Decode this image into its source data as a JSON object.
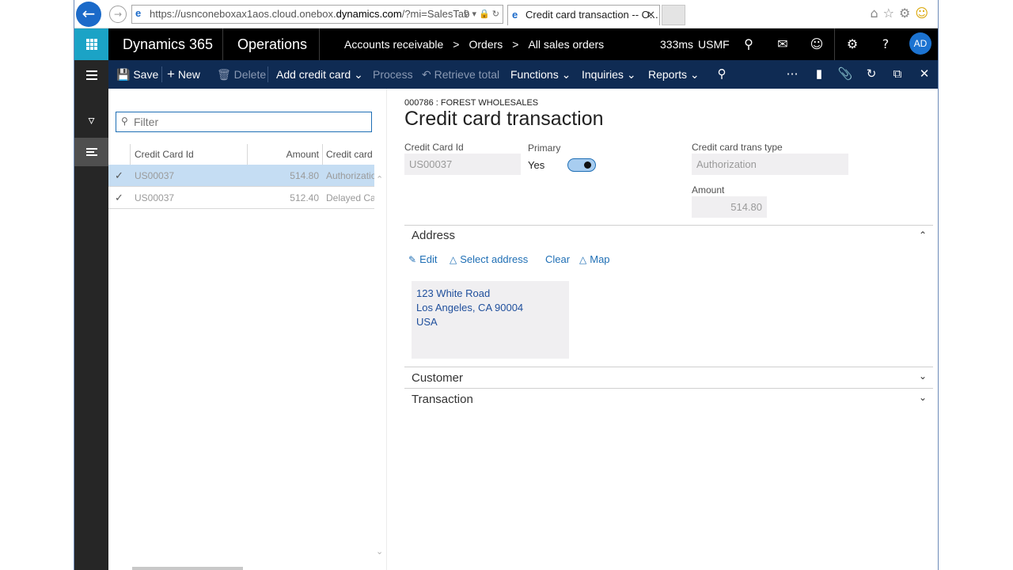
{
  "browser": {
    "url_prefix": "https://usnconeboxax1aos.cloud.onebox.",
    "url_host": "dynamics.com",
    "url_suffix": "/?mi=SalesTab",
    "tab_title": "Credit card transaction -- O..."
  },
  "header": {
    "brand": "Dynamics 365",
    "module": "Operations",
    "breadcrumbs": [
      "Accounts receivable",
      "Orders",
      "All sales orders"
    ],
    "perf": "333ms",
    "company": "USMF",
    "avatar_initials": "AD"
  },
  "action_pane": {
    "save": "Save",
    "new": "New",
    "delete": "Delete",
    "add_credit_card": "Add credit card",
    "process": "Process",
    "retrieve_total": "Retrieve total",
    "functions": "Functions",
    "inquiries": "Inquiries",
    "reports": "Reports"
  },
  "list": {
    "filter_placeholder": "Filter",
    "columns": [
      "Credit Card Id",
      "Amount",
      "Credit card trans"
    ],
    "rows": [
      {
        "id": "US00037",
        "amount": "514.80",
        "type": "Authorization"
      },
      {
        "id": "US00037",
        "amount": "512.40",
        "type": "Delayed Ca"
      }
    ]
  },
  "details": {
    "caption": "000786 : FOREST WHOLESALES",
    "title": "Credit card transaction",
    "credit_card_id_label": "Credit Card Id",
    "credit_card_id": "US00037",
    "primary_label": "Primary",
    "primary_value": "Yes",
    "trans_type_label": "Credit card trans type",
    "trans_type": "Authorization",
    "amount_label": "Amount",
    "amount": "514.80"
  },
  "address": {
    "header": "Address",
    "edit": "Edit",
    "select_address": "Select address",
    "clear": "Clear",
    "map": "Map",
    "line1": "123 White Road",
    "line2": "Los Angeles, CA 90004",
    "line3": "USA"
  },
  "sections": {
    "customer": "Customer",
    "transaction": "Transaction"
  },
  "colors": {
    "accent": "#1ba3c6",
    "action_pane": "#0f2b53",
    "selected_row": "#c5ddf3",
    "link": "#1f6fb5"
  }
}
